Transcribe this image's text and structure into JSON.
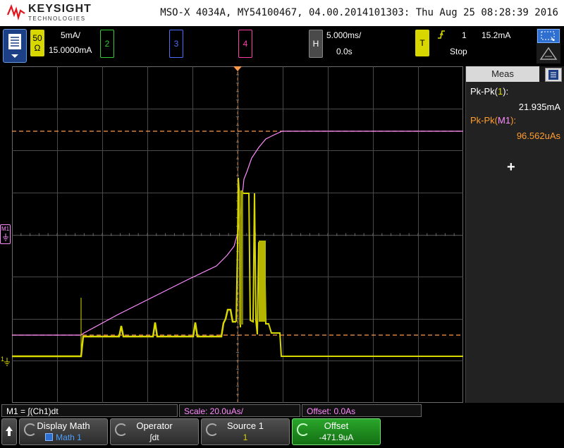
{
  "brand": {
    "name": "KEYSIGHT",
    "sub": "TECHNOLOGIES"
  },
  "scope_info": "MSO-X 4034A, MY54100467, 04.00.2014101303: Thu Aug 25 08:28:39 2016",
  "ch1": {
    "impedance_top": "50",
    "impedance_bottom": "Ω",
    "scale": "5mA/",
    "offset": "15.0000mA",
    "color": "#d8d800"
  },
  "ch2": {
    "label": "2",
    "color": "#33cc33"
  },
  "ch3": {
    "label": "3",
    "color": "#4f6cff"
  },
  "ch4": {
    "label": "4",
    "color": "#ff3fa8"
  },
  "horizontal": {
    "label": "H",
    "time_scale": "5.000ms/",
    "delay": "0.0s"
  },
  "trigger": {
    "label": "T",
    "edge_icon": "rising-edge-icon",
    "source": "1",
    "level": "15.2mA",
    "mode": "Stop"
  },
  "markers": {
    "m1": "M1",
    "one": "1"
  },
  "side_panel": {
    "title": "Meas",
    "m1_label_prefix": "Pk-Pk(",
    "m1_ch": "1",
    "m1_label_suffix": "):",
    "m1_value": "21.935mA",
    "m2_label_prefix": "Pk-Pk(",
    "m2_ch": "M1",
    "m2_label_suffix": "):",
    "m2_value": "96.562uAs",
    "add_symbol": "+"
  },
  "function_bar": {
    "math_def": "M1 = ∫(Ch1)dt",
    "scale": "Scale: 20.0uAs/",
    "offset": "Offset: 0.0As"
  },
  "softkeys": [
    {
      "label": "Display Math",
      "value": "Math 1"
    },
    {
      "label": "Operator",
      "value": "∫dt"
    },
    {
      "label": "Source 1",
      "value": "1"
    },
    {
      "label": "Offset",
      "value": "-471.9uA"
    }
  ],
  "colors": {
    "ch1": "#d8d800",
    "math": "#ff8cff",
    "cursor_line": "#ff9a4a",
    "grid": "#6b6b6b",
    "meas_accent": "#ff9d2e"
  }
}
